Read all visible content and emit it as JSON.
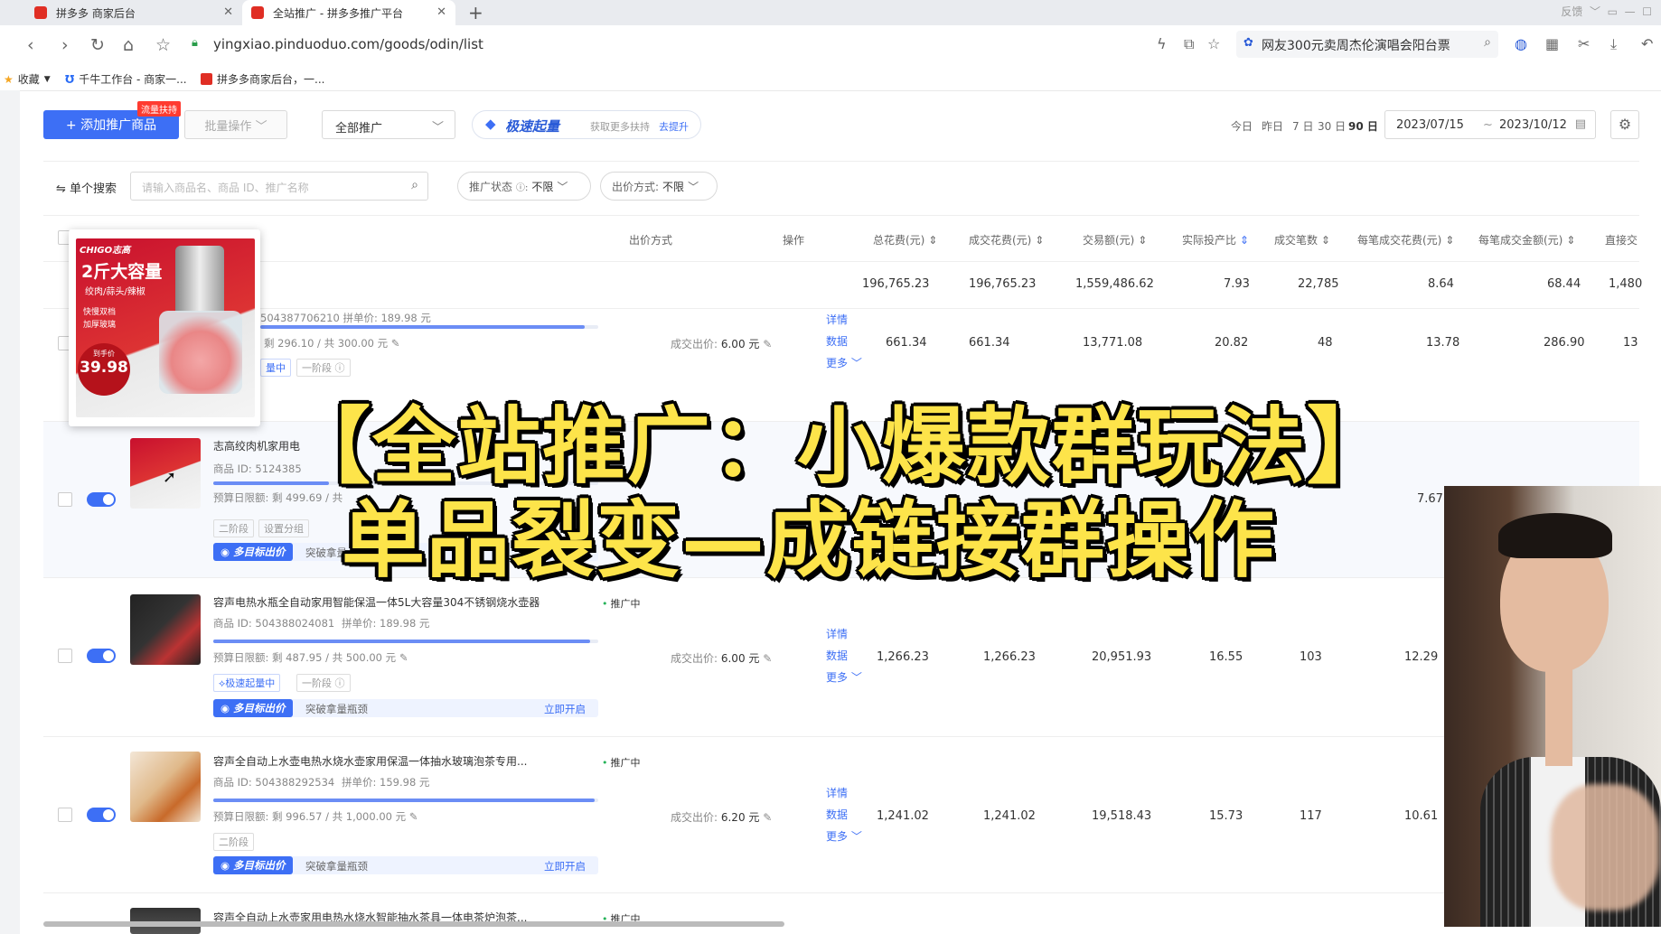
{
  "browser": {
    "tabs": [
      {
        "label": "拼多多 商家后台",
        "active": false
      },
      {
        "label": "全站推广 - 拼多多推广平台",
        "active": true
      }
    ],
    "url": "yingxiao.pinduoduo.com/goods/odin/list",
    "hot_search": "网友300元卖周杰伦演唱会阳台票",
    "window_label": "反馈",
    "bookmarks": [
      "收藏",
      "千牛工作台 - 商家一...",
      "拼多多商家后台，一..."
    ]
  },
  "toolbar": {
    "add_button": "+ 添加推广商品",
    "add_badge": "流量扶持",
    "batch_button": "批量操作",
    "all_promo_select": "全部推广",
    "fast_label": "极速起量",
    "fast_hint": "获取更多扶持",
    "fast_link": "去提升",
    "date_presets": [
      "今日",
      "昨日",
      "7 日",
      "30 日",
      "90 日"
    ],
    "date_start": "2023/07/15",
    "date_sep": "~",
    "date_end": "2023/10/12"
  },
  "filter": {
    "search_label": "单个搜索",
    "search_placeholder": "请输入商品名、商品 ID、推广名称",
    "status_label": "推广状态",
    "status_value": "不限",
    "bid_label": "出价方式:",
    "bid_value": "不限"
  },
  "table": {
    "headers": [
      "出价方式",
      "操作",
      "总花费(元)",
      "成交花费(元)",
      "交易额(元)",
      "实际投产比",
      "成交笔数",
      "每笔成交花费(元)",
      "每笔成交金额(元)",
      "直接交"
    ],
    "totals": [
      "196,765.23",
      "196,765.23",
      "1,559,486.62",
      "7.93",
      "22,785",
      "8.64",
      "68.44",
      "1,480"
    ],
    "rows": [
      {
        "name": "",
        "meta": "504387706210   拼单价: 189.98 元",
        "budget": "剩 296.10 / 共 300.00 元",
        "tags": [
          "量中",
          "一阶段"
        ],
        "bid": "成交出价: ",
        "bid_value": "6.00 元",
        "ops": [
          "详情",
          "数据",
          "更多"
        ],
        "values": [
          "661.34",
          "661.34",
          "13,771.08",
          "20.82",
          "48",
          "13.78",
          "286.90",
          "13"
        ],
        "progress": 0.96
      },
      {
        "name": "志高绞肉机家用电",
        "meta_id": "商品 ID: 5124385",
        "budget": "预算日限额: 剩 499.69 / 共",
        "tags": [
          "二阶段",
          "设置分组"
        ],
        "multi_label": "多目标出价",
        "multi_text": "突破拿量",
        "values": [
          "7.67"
        ],
        "progress": 0.3
      },
      {
        "name": "容声电热水瓶全自动家用智能保温一体5L大容量304不锈钢烧水壶器",
        "status": "推广中",
        "meta_id": "商品 ID: 504388024081",
        "meta_price": "拼单价: 189.98 元",
        "budget": "预算日限额: 剩 487.95 / 共 500.00 元",
        "tags": [
          "极速起量中",
          "一阶段"
        ],
        "multi_label": "多目标出价",
        "multi_text": "突破拿量瓶颈",
        "multi_link": "立即开启",
        "bid": "成交出价: ",
        "bid_value": "6.00 元",
        "ops": [
          "详情",
          "数据",
          "更多"
        ],
        "values": [
          "1,266.23",
          "1,266.23",
          "20,951.93",
          "16.55",
          "103",
          "12.29"
        ],
        "progress": 0.98
      },
      {
        "name": "容声全自动上水壶电热水烧水壶家用保温一体抽水玻璃泡茶专用...",
        "status": "推广中",
        "meta_id": "商品 ID: 504388292534",
        "meta_price": "拼单价: 159.98 元",
        "budget": "预算日限额: 剩 996.57 / 共 1,000.00 元",
        "tags": [
          "二阶段"
        ],
        "multi_label": "多目标出价",
        "multi_text": "突破拿量瓶颈",
        "multi_link": "立即开启",
        "bid": "成交出价: ",
        "bid_value": "6.20 元",
        "ops": [
          "详情",
          "数据",
          "更多"
        ],
        "values": [
          "1,241.02",
          "1,241.02",
          "19,518.43",
          "15.73",
          "117",
          "10.61"
        ],
        "progress": 0.99
      },
      {
        "name": "容声全自动上水壶家用电热水烧水智能抽水茶具一体电茶炉泡茶...",
        "status": "推广中"
      }
    ]
  },
  "preview": {
    "brand": "CHIGO志高",
    "headline": "2斤大容量",
    "sub": "绞肉/蒜头/辣椒",
    "features": [
      "快慢双档",
      "加厚玻璃"
    ],
    "price_label": "到手价",
    "price": "39.98"
  },
  "overlay": {
    "line1": "【全站推广：小爆款群玩法】",
    "line2": "单品裂变—成链接群操作"
  },
  "colors": {
    "accent": "#3d6ff5",
    "overlay_text": "#fde44a",
    "brand_red": "#e02e24"
  }
}
